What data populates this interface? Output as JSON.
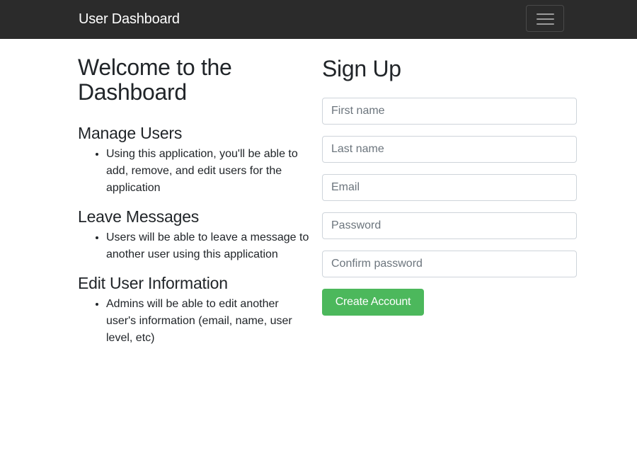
{
  "navbar": {
    "brand": "User Dashboard",
    "toggler_icon": "hamburger-icon"
  },
  "intro": {
    "title": "Welcome to the Dashboard",
    "sections": [
      {
        "heading": "Manage Users",
        "bullet": "Using this application, you'll be able to add, remove, and edit users for the application"
      },
      {
        "heading": "Leave Messages",
        "bullet": "Users will be able to leave a message to another user using this application"
      },
      {
        "heading": "Edit User Information",
        "bullet": "Admins will be able to edit another user's information (email, name, user level, etc)"
      }
    ]
  },
  "signup": {
    "title": "Sign Up",
    "fields": {
      "first_name": {
        "value": "",
        "placeholder": "First name"
      },
      "last_name": {
        "value": "",
        "placeholder": "Last name"
      },
      "email": {
        "value": "",
        "placeholder": "Email"
      },
      "password": {
        "value": "",
        "placeholder": "Password"
      },
      "confirm_password": {
        "value": "",
        "placeholder": "Confirm password"
      }
    },
    "submit_label": "Create Account"
  },
  "colors": {
    "navbar_bg": "#2b2b2b",
    "primary_button": "#4cb85c",
    "text": "#212529"
  }
}
